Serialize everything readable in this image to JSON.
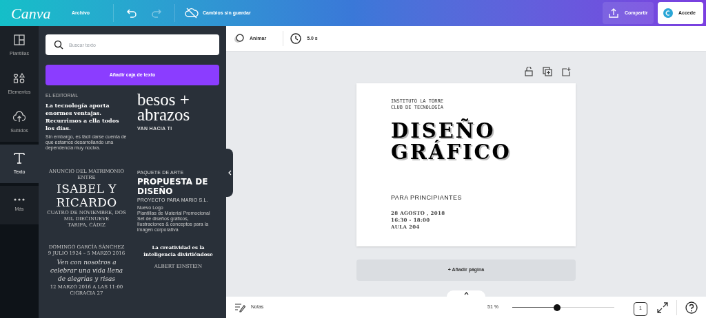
{
  "topbar": {
    "logo": "Canva",
    "file_menu": "Archivo",
    "save_status": "Cambios sin guardar",
    "share": "Compartir",
    "account": "Accede"
  },
  "sidebar": {
    "items": [
      {
        "label": "Plantillas",
        "selected": false
      },
      {
        "label": "Elementos",
        "selected": false
      },
      {
        "label": "Subidos",
        "selected": false
      },
      {
        "label": "Texto",
        "selected": true
      },
      {
        "label": "Más",
        "selected": false
      }
    ]
  },
  "panel": {
    "search": {
      "placeholder": "Buscar texto"
    },
    "add_button": "Añadir caja de texto",
    "templates": [
      {
        "lines": [
          {
            "kind": "tiny",
            "text": "EL EDITORIAL"
          },
          {
            "kind": "boldserif",
            "text": "La tecnología aporta enormes ventajas. Recurrimos a ella todos los días."
          },
          {
            "kind": "small",
            "text": "Sin embargo, es fácil darse cuenta de que estamos desarrollando una dependencia muy nociva."
          }
        ]
      },
      {
        "lines": [
          {
            "kind": "bigserif",
            "text": "besos + abrazos"
          },
          {
            "kind": "caps",
            "text": "VAN HACIA TI"
          }
        ]
      },
      {
        "lines": [
          {
            "kind": "tinycenter",
            "text": "ANUNCIO DEL MATRIMONIO ENTRE"
          },
          {
            "kind": "slab",
            "text": "ISABEL Y RICARDO"
          },
          {
            "kind": "tinycenter",
            "text": "CUATRO DE NOVIEMBRE, DOS MIL DIECINUEVE"
          },
          {
            "kind": "tinycenter",
            "text": "TARIFA, CÁDIZ"
          }
        ]
      },
      {
        "lines": [
          {
            "kind": "spaced",
            "text": "PAQUETE DE ARTE"
          },
          {
            "kind": "heavy",
            "text": "PROPUESTA DE DISEÑO"
          },
          {
            "kind": "spaced",
            "text": "PROYECTO PARA MARIO S.L."
          },
          {
            "kind": "small",
            "text": "Nuevo Logo"
          },
          {
            "kind": "small",
            "text": "Plantillas de Material Promocional"
          },
          {
            "kind": "small",
            "text": "Set de diseños gráficos,"
          },
          {
            "kind": "small",
            "text": "Ilustraciones & conceptos para la"
          },
          {
            "kind": "small",
            "text": "imagen corporativa"
          }
        ]
      },
      {
        "lines": [
          {
            "kind": "tinycenter",
            "text": "DOMINGO GARCÍA SÁNCHEZ"
          },
          {
            "kind": "tinycenter",
            "text": "9 JULIO 1924 – 5 MARZO 2016"
          },
          {
            "kind": "script",
            "text": "Ven con nosotros a celebrar una vida llena de alegrías y risas"
          },
          {
            "kind": "tinycenter",
            "text": "12 MARZO 2016 A LAS 11:00"
          },
          {
            "kind": "tinycenter",
            "text": "C/GRACIA 27"
          }
        ]
      },
      {
        "lines": [
          {
            "kind": "boldcenter",
            "text": "La creatividad es la inteligencia divirtiéndose"
          },
          {
            "kind": "tinycenter",
            "text": "ALBERT EINSTEIN"
          }
        ]
      }
    ]
  },
  "toolbar": {
    "animate": "Animar",
    "duration": "5.0 s"
  },
  "page": {
    "lines": [
      {
        "kind": "mono",
        "text": "INSTITUTO LA TORRE"
      },
      {
        "kind": "mono",
        "text": "CLUB DE TECNOLOGÍA"
      },
      {
        "kind": "title",
        "text": "DISEÑO"
      },
      {
        "kind": "title",
        "text": "GRÁFICO"
      },
      {
        "kind": "subtitle",
        "text": "PARA PRINCIPIANTES"
      },
      {
        "kind": "detail",
        "text": "28 AGOSTO , 2018"
      },
      {
        "kind": "detail",
        "text": "16:30 - 18:00"
      },
      {
        "kind": "detail",
        "text": "AULA 204"
      }
    ]
  },
  "add_page": "+ Añadir página",
  "bottombar": {
    "notes": "Notas",
    "zoom": "51 %",
    "zoom_slider": {
      "level": 0.44
    },
    "page_count": "1"
  }
}
